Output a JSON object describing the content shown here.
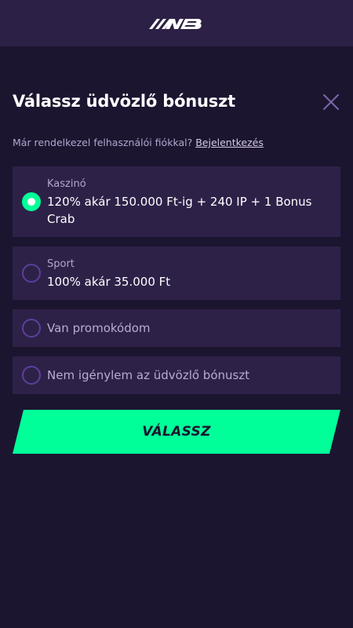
{
  "header": {
    "logo_icon": "nb-logo-icon"
  },
  "modal": {
    "title": "Válassz üdvözlő bónuszt",
    "close_icon": "close-icon",
    "login_prompt": "Már rendelkezel felhasználói fiókkal?",
    "login_link": "Bejelentkezés"
  },
  "options": [
    {
      "category": "Kaszinó",
      "label": "120% akár 150.000 Ft-ig + 240 IP + 1 Bonus Crab",
      "selected": true
    },
    {
      "category": "Sport",
      "label": "100% akár 35.000 Ft",
      "selected": false
    },
    {
      "category": "",
      "label": "Van promokódom",
      "selected": false
    },
    {
      "category": "",
      "label": "Nem igénylem az üdvözlő bónuszt",
      "selected": false
    }
  ],
  "cta": {
    "label": "VÁLASSZ"
  },
  "colors": {
    "background": "#1c1530",
    "header": "#2c2046",
    "card": "#2e2148",
    "accent": "#00ff99",
    "radio_border": "#5e3e9c"
  }
}
